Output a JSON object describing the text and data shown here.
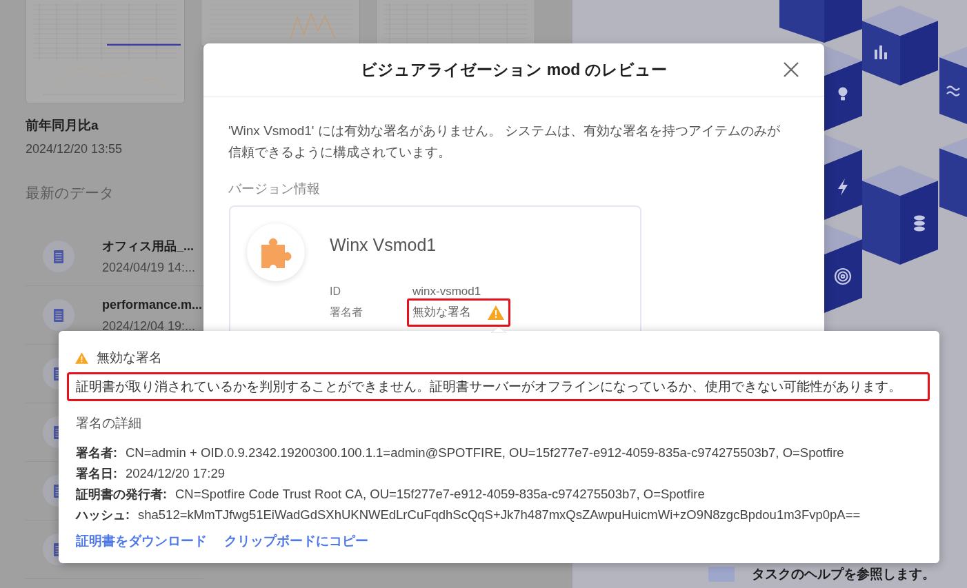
{
  "background": {
    "thumbnails": [
      {
        "kind": "table-chart"
      },
      {
        "kind": "line"
      },
      {
        "kind": "table"
      }
    ],
    "featured": {
      "title": "前年同月比a",
      "date": "2024/12/20 13:55"
    },
    "section_title": "最新のデータ",
    "recent_items": [
      {
        "kind": "document",
        "title": "オフィス用品_...",
        "date": "2024/04/19 14:..."
      },
      {
        "kind": "document",
        "title": "performance.m...",
        "date": "2024/12/04 19:..."
      },
      {
        "kind": "document"
      },
      {
        "kind": "document"
      },
      {
        "kind": "document"
      },
      {
        "kind": "document"
      }
    ],
    "help_text": "タスクのヘルプを参照します。"
  },
  "dialog": {
    "title": "ビジュアライゼーション mod のレビュー",
    "message": "'Winx Vsmod1' には有効な署名がありません。 システムは、有効な署名を持つアイテムのみが信頼できるように構成されています。",
    "section_title": "バージョン情報",
    "mod": {
      "name": "Winx Vsmod1",
      "fields": [
        {
          "kind": "text",
          "label": "ID",
          "value": "winx-vsmod1",
          "highlighted": false
        },
        {
          "kind": "warning",
          "label": "署名者",
          "value": "無効な署名",
          "highlighted": true
        }
      ]
    }
  },
  "popover": {
    "title": "無効な署名",
    "message": {
      "text": "証明書が取り消されているかを判別することができません。証明書サーバーがオフラインになっているか、使用できない可能性があります。",
      "highlighted": true
    },
    "details_title": "署名の詳細",
    "details": [
      {
        "label": "署名者:",
        "value": "CN=admin + OID.0.9.2342.19200300.100.1.1=admin@SPOTFIRE, OU=15f277e7-e912-4059-835a-c974275503b7, O=Spotfire"
      },
      {
        "label": "署名日:",
        "value": "2024/12/20 17:29"
      },
      {
        "label": "証明書の発行者:",
        "value": "CN=Spotfire Code Trust Root CA, OU=15f277e7-e912-4059-835a-c974275503b7, O=Spotfire"
      },
      {
        "label": "ハッシュ:",
        "value": "sha512=kMmTJfwg51EiWadGdSXhUKNWEdLrCuFqdhScQqS+Jk7h487mxQsZAwpuHuicmWi+zO9N8zgcBpdou1m3Fvp0pA=="
      }
    ],
    "links": [
      "証明書をダウンロード",
      "クリップボードにコピー"
    ]
  }
}
